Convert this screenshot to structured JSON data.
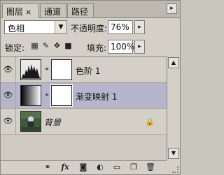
{
  "tabs": [
    {
      "label": "图层",
      "close": "×"
    },
    {
      "label": "通道"
    },
    {
      "label": "路径"
    }
  ],
  "panel_menu_icon": "▸",
  "blend_mode": {
    "value": "色相",
    "dropdown_icon": "▼"
  },
  "opacity": {
    "label": "不透明度:",
    "value": "76%",
    "arrow": "▸"
  },
  "lock": {
    "label": "锁定:"
  },
  "fill": {
    "label": "填充:",
    "value": "100%",
    "arrow": "▸"
  },
  "layers": [
    {
      "name": "色阶 1",
      "eye": "👁",
      "selected": false
    },
    {
      "name": "渐变映射 1",
      "eye": "👁",
      "selected": true
    },
    {
      "name": "背景",
      "eye": "👁",
      "selected": false,
      "locked": true
    }
  ],
  "scroll": {
    "up": "▲",
    "down": "▼"
  },
  "toolbar_icons": [
    "link-icon",
    "fx-icon",
    "mask-icon",
    "adjustment-icon",
    "group-icon",
    "new-layer-icon",
    "trash-icon"
  ]
}
